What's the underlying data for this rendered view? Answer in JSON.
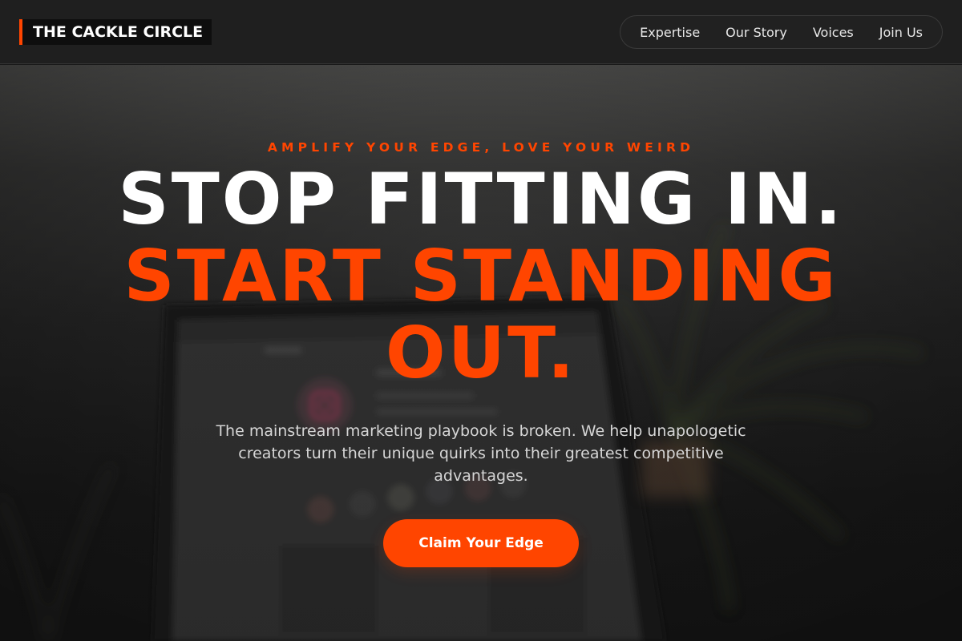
{
  "header": {
    "logo_text": "THE CACKLE CIRCLE",
    "nav": [
      {
        "label": "Expertise"
      },
      {
        "label": "Our Story"
      },
      {
        "label": "Voices"
      },
      {
        "label": "Join Us"
      }
    ]
  },
  "hero": {
    "eyebrow": "AMPLIFY YOUR EDGE, LOVE YOUR WEIRD",
    "headline_line1": "STOP FITTING IN.",
    "headline_line2": "START STANDING",
    "headline_line3": "OUT.",
    "subtext": "The mainstream marketing playbook is broken. We help unapologetic creators turn their unique quirks into their greatest competitive advantages.",
    "cta_label": "Claim Your Edge",
    "background_image": "blurred laptop showing Instagram with plant"
  },
  "colors": {
    "accent": "#ff4500",
    "header_bg": "#1f1f1f",
    "text_primary": "#ffffff",
    "text_secondary": "#d6d6d6"
  }
}
